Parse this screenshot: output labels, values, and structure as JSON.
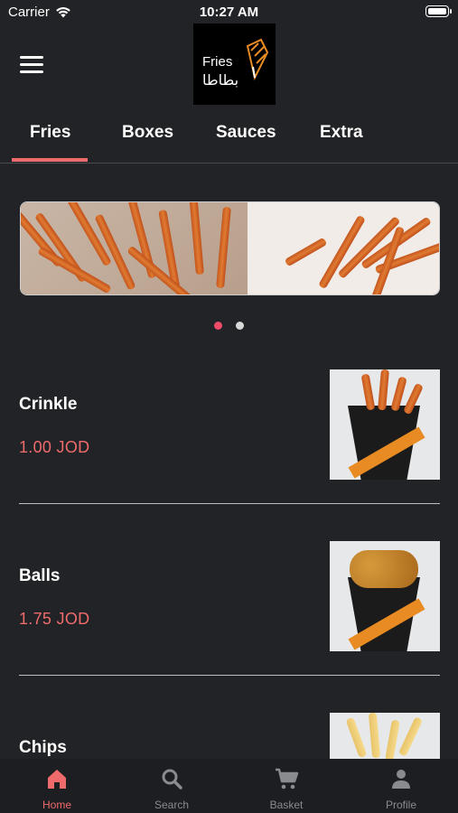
{
  "status": {
    "carrier": "Carrier",
    "time": "10:27 AM"
  },
  "header": {
    "logo_text_en": "Fries",
    "logo_text_ar": "بطاطا"
  },
  "tabs": [
    {
      "label": "Fries",
      "active": true
    },
    {
      "label": "Boxes",
      "active": false
    },
    {
      "label": "Sauces",
      "active": false
    },
    {
      "label": "Extra",
      "active": false
    }
  ],
  "carousel": {
    "slide_count": 2,
    "active_index": 0
  },
  "products": [
    {
      "name": "Crinkle",
      "price": "1.00 JOD"
    },
    {
      "name": "Balls",
      "price": "1.75 JOD"
    },
    {
      "name": "Chips",
      "price": ""
    }
  ],
  "bottom_nav": [
    {
      "label": "Home",
      "icon": "home-icon",
      "active": true
    },
    {
      "label": "Search",
      "icon": "search-icon",
      "active": false
    },
    {
      "label": "Basket",
      "icon": "cart-icon",
      "active": false
    },
    {
      "label": "Profile",
      "icon": "person-icon",
      "active": false
    }
  ],
  "colors": {
    "accent": "#ef6b6b",
    "background": "#222326",
    "nav_background": "#1d1e21",
    "inactive": "#8a8b8f"
  }
}
